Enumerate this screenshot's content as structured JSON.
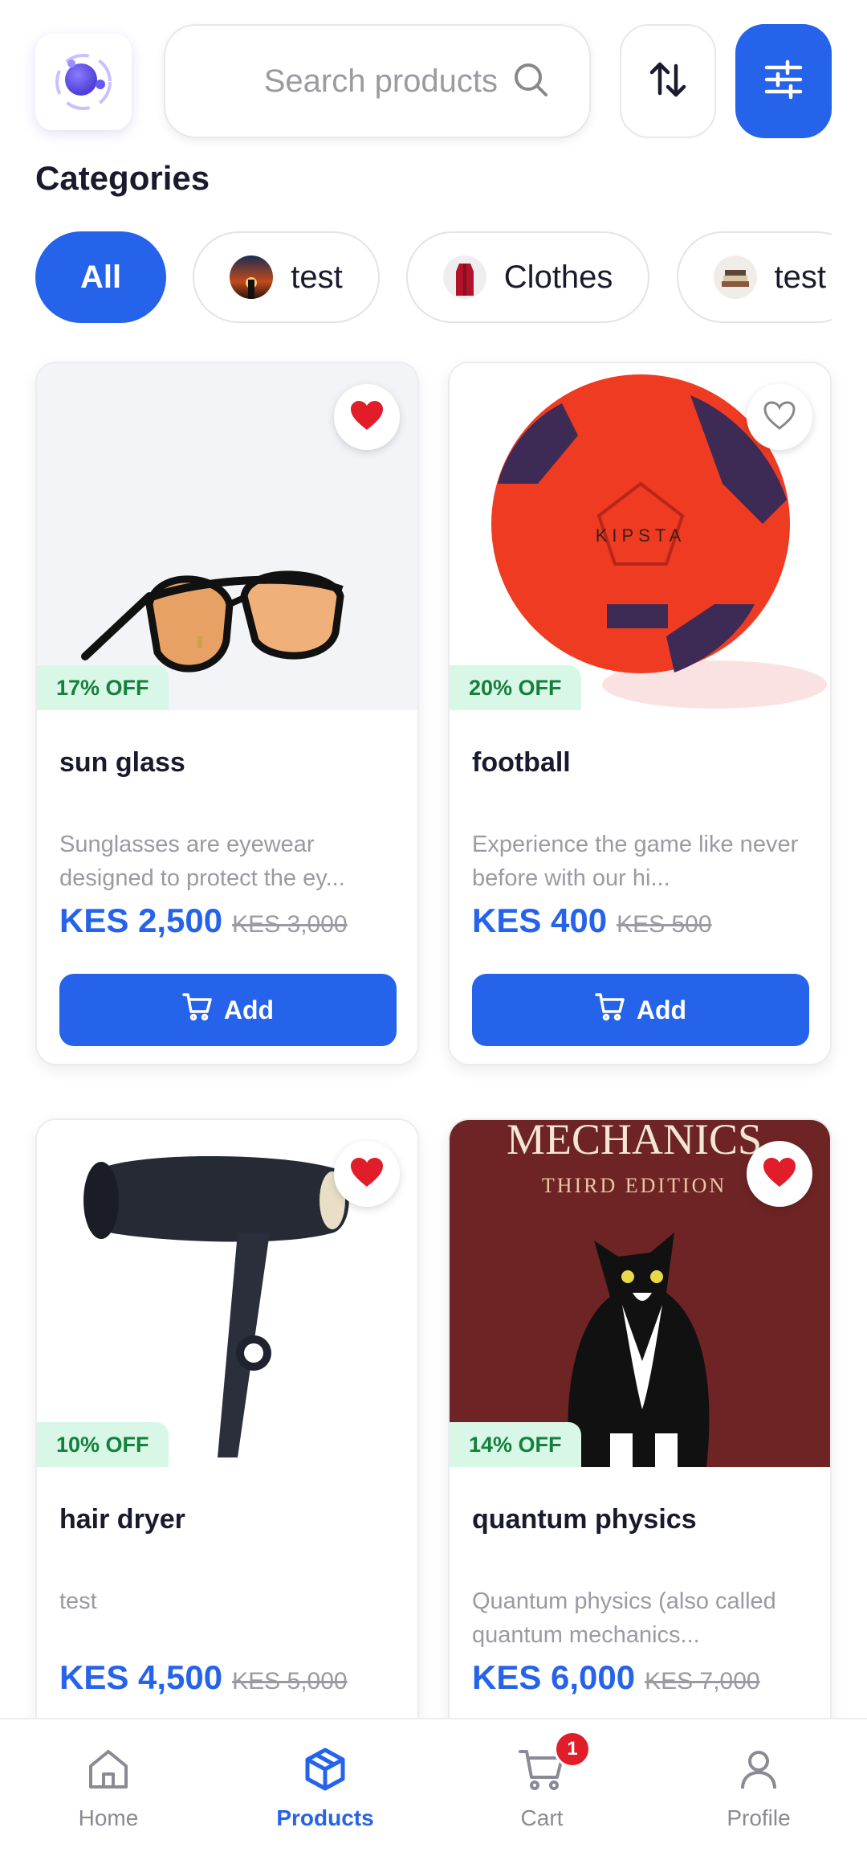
{
  "header": {
    "search_placeholder": "Search products",
    "icons": {
      "logo": "app-logo-icon",
      "search": "search-icon",
      "sort": "sort-icon",
      "filter": "filter-sliders-icon"
    }
  },
  "categories": {
    "title": "Categories",
    "items": [
      {
        "label": "All",
        "active": true
      },
      {
        "label": "test",
        "thumb": "sunset-thumb"
      },
      {
        "label": "Clothes",
        "thumb": "red-coat-thumb"
      },
      {
        "label": "test",
        "thumb": "books-thumb"
      }
    ]
  },
  "products": [
    {
      "name": "sun glass",
      "desc": "Sunglasses are eyewear designed to protect the ey...",
      "price": "KES 2,500",
      "old_price": "KES 3,000",
      "discount": "17% OFF",
      "favorite": true,
      "add_label": "Add"
    },
    {
      "name": "football",
      "desc": "Experience the game like never before with our hi...",
      "price": "KES 400",
      "old_price": "KES 500",
      "discount": "20% OFF",
      "favorite": false,
      "add_label": "Add"
    },
    {
      "name": "hair dryer",
      "desc": "test",
      "price": "KES 4,500",
      "old_price": "KES 5,000",
      "discount": "10% OFF",
      "favorite": true
    },
    {
      "name": "quantum physics",
      "desc": "Quantum physics (also called quantum mechanics...",
      "price": "KES 6,000",
      "old_price": "KES 7,000",
      "discount": "14% OFF",
      "favorite": true,
      "image_text": {
        "title": "MECHANICS",
        "subtitle": "THIRD EDITION"
      }
    }
  ],
  "bottom_nav": [
    {
      "label": "Home",
      "icon": "home-icon"
    },
    {
      "label": "Products",
      "icon": "box-icon",
      "active": true
    },
    {
      "label": "Cart",
      "icon": "cart-icon",
      "badge": "1"
    },
    {
      "label": "Profile",
      "icon": "user-icon"
    }
  ],
  "colors": {
    "primary": "#2563eb",
    "badge_bg": "#d9f7e6",
    "badge_text": "#15803d",
    "heart": "#e11d2a"
  }
}
